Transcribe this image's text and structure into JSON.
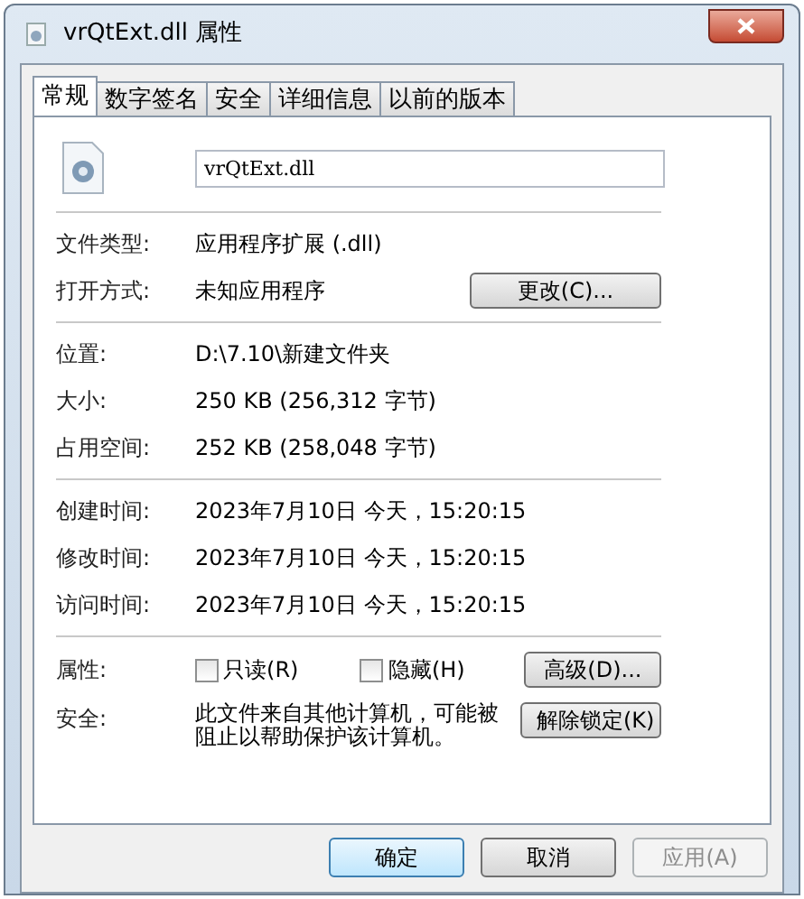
{
  "window": {
    "title": "vrQtExt.dll 属性"
  },
  "tabs": [
    {
      "label": "常规",
      "selected": true
    },
    {
      "label": "数字签名",
      "selected": false
    },
    {
      "label": "安全",
      "selected": false
    },
    {
      "label": "详细信息",
      "selected": false
    },
    {
      "label": "以前的版本",
      "selected": false
    }
  ],
  "file": {
    "name": "vrQtExt.dll"
  },
  "type_rows": [
    {
      "label": "文件类型:",
      "value": "应用程序扩展 (.dll)"
    },
    {
      "label": "打开方式:",
      "value": "未知应用程序",
      "button": "更改(C)..."
    }
  ],
  "size_rows": [
    {
      "label": "位置:",
      "value": "D:\\7.10\\新建文件夹"
    },
    {
      "label": "大小:",
      "value": "250 KB (256,312 字节)"
    },
    {
      "label": "占用空间:",
      "value": "252 KB (258,048 字节)"
    }
  ],
  "time_rows": [
    {
      "label": "创建时间:",
      "value": "2023年7月10日 今天，15:20:15"
    },
    {
      "label": "修改时间:",
      "value": "2023年7月10日 今天，15:20:15"
    },
    {
      "label": "访问时间:",
      "value": "2023年7月10日 今天，15:20:15"
    }
  ],
  "attributes": {
    "label": "属性:",
    "checkboxes": [
      {
        "label": "只读(R)",
        "checked": false
      },
      {
        "label": "隐藏(H)",
        "checked": false
      }
    ],
    "button": "高级(D)..."
  },
  "security": {
    "label": "安全:",
    "text": "此文件来自其他计算机，可能被阻止以帮助保护该计算机。",
    "button": "解除锁定(K)"
  },
  "buttons": [
    {
      "label": "确定",
      "default": true,
      "disabled": false
    },
    {
      "label": "取消",
      "default": false,
      "disabled": false
    },
    {
      "label": "应用(A)",
      "default": false,
      "disabled": true
    }
  ]
}
